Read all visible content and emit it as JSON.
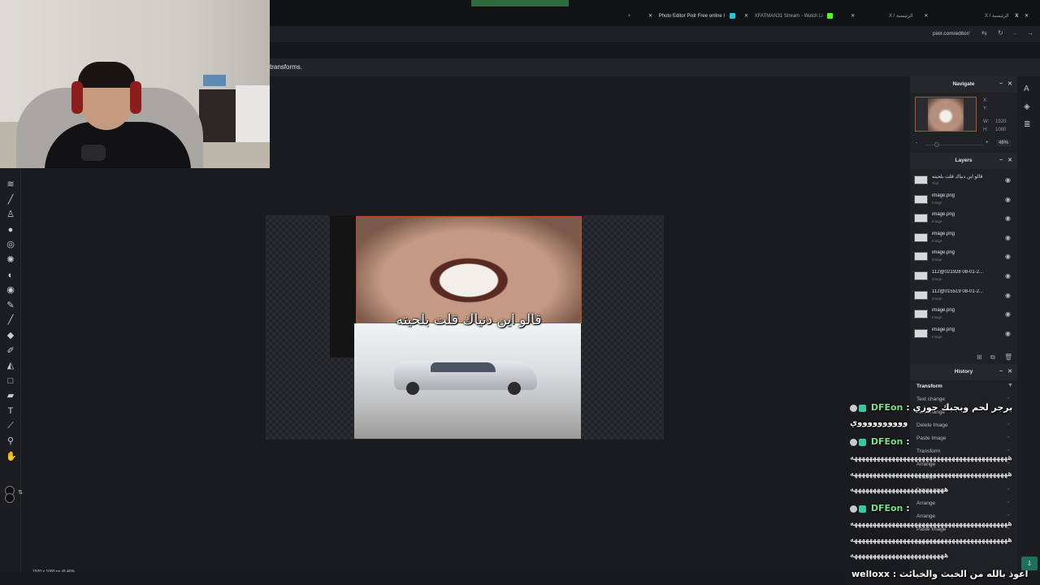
{
  "browser": {
    "tabs": [
      {
        "title": "Photo Editor Pixlr Free online I",
        "active": true
      },
      {
        "title": "XFATMAN31 Stream - Watch Li",
        "active": false
      },
      {
        "title": "X / الرئيسية",
        "active": false
      },
      {
        "title": "X / الرئيسية",
        "active": false
      }
    ],
    "new_tab": "+",
    "url": "pixlr.com/editor/",
    "message": "transforms."
  },
  "toolbar": {
    "icons": [
      "liquify-icon",
      "brush-icon",
      "clone-stamp-icon",
      "blur-icon",
      "sponge-icon",
      "heal-icon",
      "dodge-icon",
      "burn-icon",
      "pencil-icon",
      "draw-icon",
      "eraser-icon",
      "color-replace-icon",
      "fill-icon",
      "shape-icon",
      "eraser2-icon",
      "text-icon",
      "eyedropper-icon",
      "zoom-icon",
      "hand-icon"
    ]
  },
  "canvas": {
    "overlay_text": "قالو اين دنياك قلت بلحيته",
    "status": "1920 x 1080 px @ 46%"
  },
  "navigate": {
    "title": "Navigate",
    "x_label": "X:",
    "y_label": "Y:",
    "w_label": "W:",
    "w_value": "1920",
    "h_label": "H:",
    "h_value": "1080",
    "zoom": "46%",
    "zoom_minus": "-",
    "zoom_plus": "+"
  },
  "layers": {
    "title": "Layers",
    "items": [
      {
        "name": "قالو اين دنياك قلت بلحيته",
        "type": "Text"
      },
      {
        "name": "image.png",
        "type": "Image"
      },
      {
        "name": "image.png",
        "type": "Image"
      },
      {
        "name": "image.png",
        "type": "Image"
      },
      {
        "name": "image.png",
        "type": "Image"
      },
      {
        "name": "112@021928 08-01-2...",
        "type": "Image"
      },
      {
        "name": "112@015519 08-01-2...",
        "type": "Image"
      },
      {
        "name": "image.png",
        "type": "Image"
      },
      {
        "name": "image.png",
        "type": "Image"
      }
    ]
  },
  "history": {
    "title": "History",
    "items": [
      {
        "label": "Transform",
        "active": true
      },
      {
        "label": "Text change",
        "active": false
      },
      {
        "label": "Text change",
        "active": false
      },
      {
        "label": "Delete Image",
        "active": false
      },
      {
        "label": "Paste Image",
        "active": false
      },
      {
        "label": "Transform",
        "active": false
      },
      {
        "label": "Arrange",
        "active": false
      },
      {
        "label": "Arrange",
        "active": false
      },
      {
        "label": "Delete Image",
        "active": false
      },
      {
        "label": "Arrange",
        "active": false
      },
      {
        "label": "Arrange",
        "active": false
      },
      {
        "label": "Paste Image",
        "active": false
      },
      {
        "label": "Layer order",
        "active": false
      }
    ]
  },
  "chat": {
    "messages": [
      {
        "user": "DFEon",
        "sep": " :",
        "text": "برجر لحم وبجبك جوزي",
        "cont": "ووووووووووي"
      },
      {
        "user": "DFEon",
        "sep": " :",
        "wave1": "ههههههههههههههههههههههههههههههههههههههههههه",
        "wave2": "ههههههههههههههههههههههههههههههههههههههههههه",
        "wave3": "هههههههههههههههههههههههههه"
      },
      {
        "user": "DFEon",
        "sep": " :",
        "wave1": "ههههههههههههههههههههههههههههههههههههههههههه",
        "wave2": "ههههههههههههههههههههههههههههههههههههههههههه",
        "wave3": "هههههههههههههههههههههههههه"
      },
      {
        "user": "welloxx",
        "sep": " :",
        "text": "اعوذ بالله من الخبث والخبائث"
      }
    ]
  },
  "colors": {
    "accent": "#c0472e",
    "chat_user": "#7be08a"
  }
}
